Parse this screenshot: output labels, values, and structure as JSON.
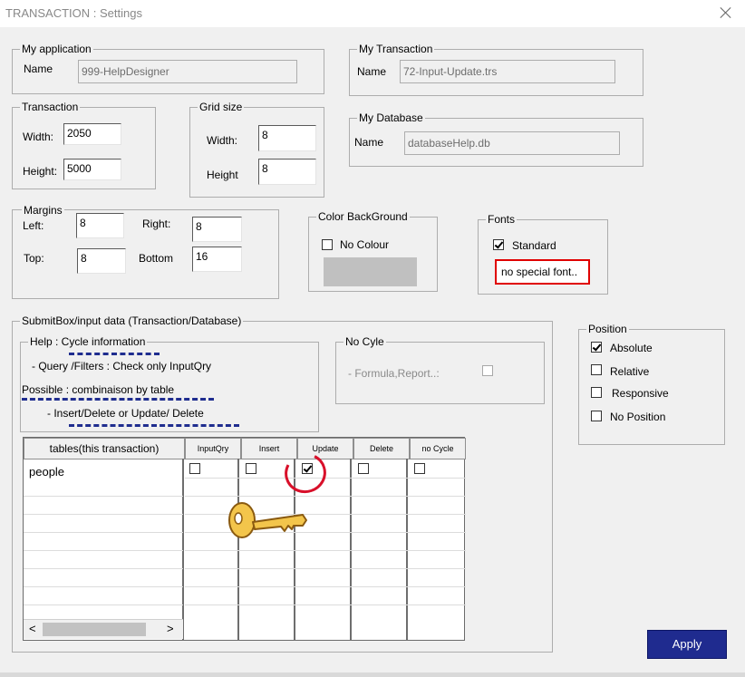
{
  "window": {
    "title": "TRANSACTION : Settings"
  },
  "my_application": {
    "label": "My application",
    "name_label": "Name",
    "name_value": "999-HelpDesigner"
  },
  "my_transaction": {
    "label": "My Transaction",
    "name_label": "Name",
    "name_value": "72-Input-Update.trs"
  },
  "my_database": {
    "label": "My  Database",
    "name_label": "Name",
    "name_value": "databaseHelp.db"
  },
  "transaction": {
    "label": "Transaction",
    "width_label": "Width:",
    "width_value": "2050",
    "height_label": "Height:",
    "height_value": "5000"
  },
  "grid_size": {
    "label": "Grid size",
    "width_label": "Width:",
    "width_value": "8",
    "height_label": "Height",
    "height_value": "8"
  },
  "margins": {
    "label": "Margins",
    "left_label": "Left:",
    "left_value": "8",
    "right_label": "Right:",
    "right_value": "8",
    "top_label": "Top:",
    "top_value": "8",
    "bottom_label": "Bottom",
    "bottom_value": "16"
  },
  "color_background": {
    "label": "Color BackGround",
    "no_colour_label": "No Colour",
    "no_colour_checked": false,
    "swatch_color": "#c0c0c0"
  },
  "fonts": {
    "label": "Fonts",
    "standard_label": "Standard",
    "standard_checked": true,
    "info": "no special font.."
  },
  "submitbox": {
    "label": "SubmitBox/input data (Transaction/Database)",
    "help": {
      "label": "Help : Cycle information",
      "line1": "- Query /Filters   : Check only InputQry",
      "line2": "Possible : combinaison by table",
      "line3": "- Insert/Delete or  Update/ Delete"
    },
    "no_cycle": {
      "label": "No Cyle",
      "formula_label": "- Formula,Report..:",
      "checked": false
    }
  },
  "table_grid": {
    "columns": [
      "tables(this transaction)",
      "InputQry",
      "Insert",
      "Update",
      "Delete",
      "no Cycle"
    ],
    "rows": [
      {
        "table": "people",
        "inputqry": false,
        "insert": false,
        "update": true,
        "delete": false,
        "no_cycle": false
      }
    ],
    "scroll_left": "<",
    "scroll_right": ">"
  },
  "position": {
    "label": "Position",
    "options": [
      {
        "label": "Absolute",
        "checked": true
      },
      {
        "label": "Relative",
        "checked": false
      },
      {
        "label": "Responsive",
        "checked": false
      },
      {
        "label": "No Position",
        "checked": false
      }
    ]
  },
  "apply_label": "Apply",
  "colors": {
    "accent": "#1f2b8f",
    "highlight": "#d8102a",
    "annotation_dash": "#1f2d8f"
  }
}
